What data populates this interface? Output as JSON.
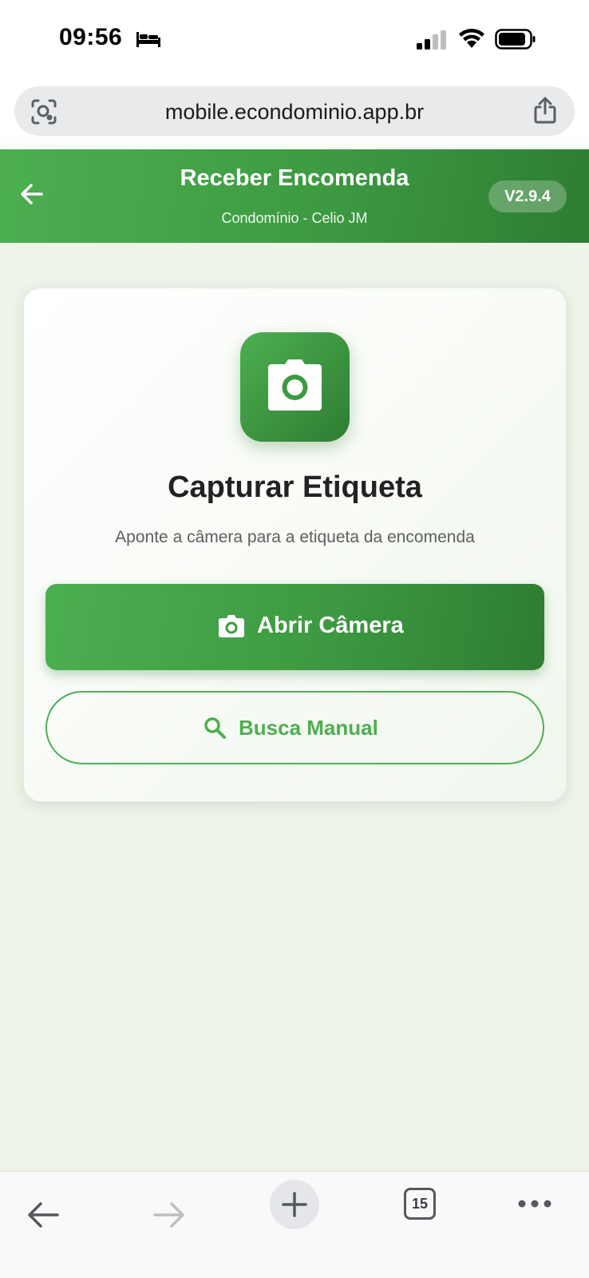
{
  "status_bar": {
    "time": "09:56",
    "icons": [
      "bed-icon",
      "signal-icon",
      "wifi-icon",
      "battery-icon"
    ]
  },
  "browser": {
    "url": "mobile.econdominio.app.br",
    "tab_count": "15",
    "icons": [
      "lens-icon",
      "share-icon",
      "back-icon",
      "forward-icon",
      "plus-icon",
      "more-icon"
    ]
  },
  "header": {
    "title": "Receber Encomenda",
    "subtitle": "Condomínio - Celio JM",
    "version": "V2.9.4"
  },
  "card": {
    "title": "Capturar Etiqueta",
    "subtitle": "Aponte a câmera para a etiqueta da encomenda",
    "primary_button": "Abrir Câmera",
    "secondary_button": "Busca Manual"
  },
  "colors": {
    "primary_green": "#4caf50",
    "dark_green": "#2e7d32",
    "background": "#eef5e8"
  }
}
